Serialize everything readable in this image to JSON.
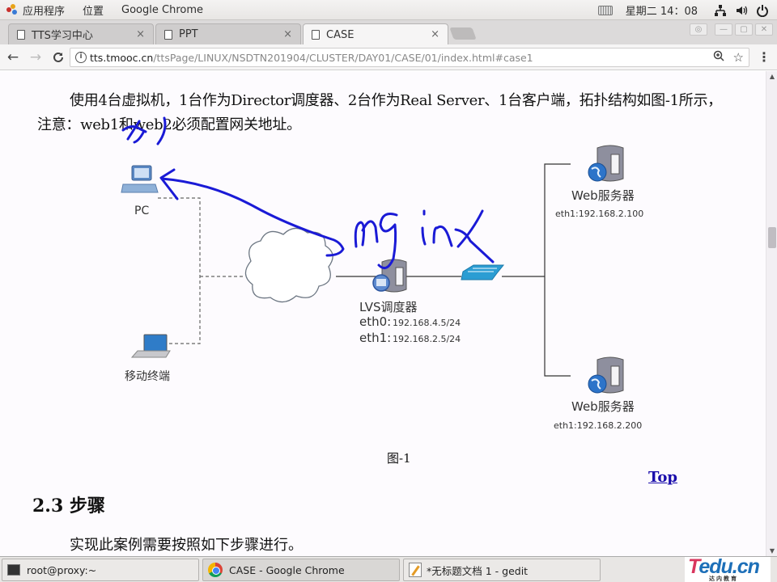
{
  "top_panel": {
    "applications": "应用程序",
    "places": "位置",
    "active_app": "Google Chrome",
    "clock": "星期二 14：08",
    "icons": [
      "keyboard-icon",
      "network-icon",
      "volume-icon",
      "power-icon"
    ]
  },
  "browser": {
    "tabs": [
      {
        "label": "TTS学习中心",
        "icon": "page-icon",
        "active": false
      },
      {
        "label": "PPT",
        "icon": "page-icon",
        "active": false
      },
      {
        "label": "CASE",
        "icon": "page-icon",
        "active": true
      }
    ],
    "close_glyph": "×",
    "url_host": "tts.tmooc.cn",
    "url_path": "/ttsPage/LINUX/NSDTN201904/CLUSTER/DAY01/CASE/01/index.html#case1",
    "nav": {
      "back": "←",
      "forward": "→",
      "reload": "C"
    }
  },
  "page": {
    "para1": "使用4台虚拟机，1台作为Director调度器、2台作为Real Server、1台客户端，拓扑结构如图-1所示，注意：web1和web2必须配置网关地址。",
    "diagram": {
      "pc_label": "PC",
      "mobile_label": "移动终端",
      "lvs_label": "LVS调度器",
      "lvs_eth0_prefix": "eth0:",
      "lvs_eth0": "192.168.4.5/24",
      "lvs_eth1_prefix": "eth1:",
      "lvs_eth1": "192.168.2.5/24",
      "web1_label": "Web服务器",
      "web1_ip": "eth1:192.168.2.100",
      "web2_label": "Web服务器",
      "web2_ip": "eth1:192.168.2.200",
      "annotation_text": "nginx",
      "annotation_color": "#1a1ad6"
    },
    "caption": "图-1",
    "top_link": "Top",
    "heading": "2.3 步骤",
    "para2": "实现此案例需要按照如下步骤进行。"
  },
  "taskbar": {
    "items": [
      {
        "label": "root@proxy:~",
        "icon": "terminal-icon",
        "active": false
      },
      {
        "label": "CASE - Google Chrome",
        "icon": "chrome-icon",
        "active": true
      },
      {
        "label": "*无标题文档 1 - gedit",
        "icon": "gedit-icon",
        "active": false
      }
    ],
    "logo_main_first": "T",
    "logo_main_rest": "edu.cn",
    "logo_sub": "达内教育"
  }
}
